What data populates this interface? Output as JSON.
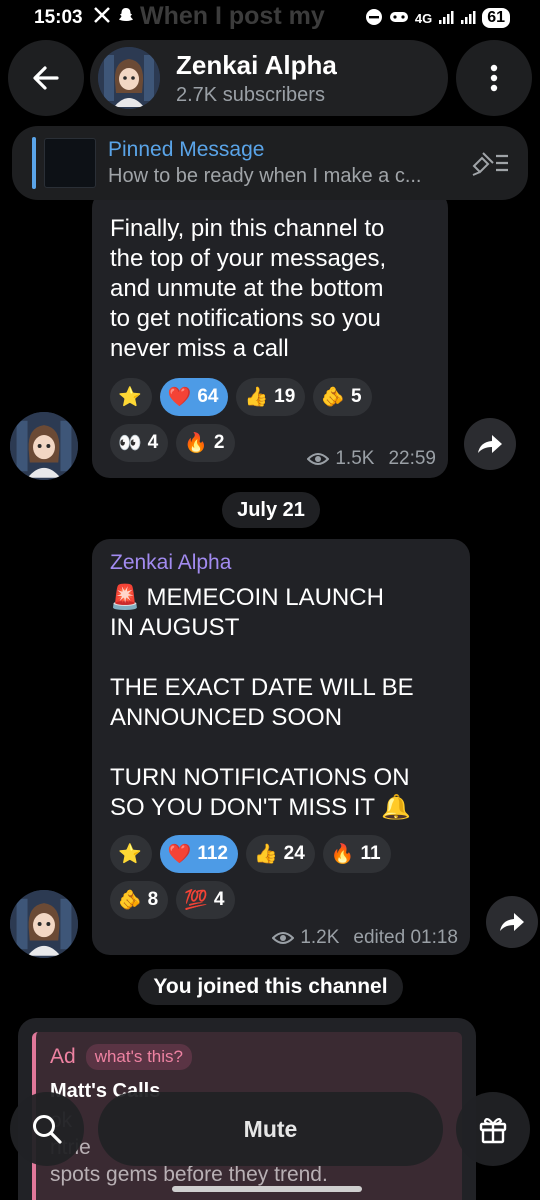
{
  "status_bar": {
    "time": "15:03",
    "left_icons": [
      "x-logo-icon",
      "snapchat-icon"
    ],
    "right_icons": [
      "dnd-icon",
      "game-icon",
      "signal-4g-icon",
      "signal-icon",
      "signal-icon"
    ],
    "network": "4G",
    "battery": "61"
  },
  "background_ghost_text": "When I post my",
  "header": {
    "channel_name": "Zenkai Alpha",
    "subscribers": "2.7K subscribers"
  },
  "pinned": {
    "label": "Pinned Message",
    "preview": "How to be ready when I make a c..."
  },
  "messages": [
    {
      "text": "Finally, pin this channel to\nthe top of your messages,\nand unmute at the bottom\nto get notifications so you\nnever miss a call",
      "reactions": [
        {
          "emoji": "⭐",
          "count": "",
          "active": false
        },
        {
          "emoji": "❤️",
          "count": "64",
          "active": true
        },
        {
          "emoji": "👍",
          "count": "19",
          "active": false
        },
        {
          "emoji": "🫵",
          "count": "5",
          "active": false
        },
        {
          "emoji": "👀",
          "count": "4",
          "active": false
        },
        {
          "emoji": "🔥",
          "count": "2",
          "active": false
        }
      ],
      "views": "1.5K",
      "time": "22:59"
    },
    {
      "sender": "Zenkai Alpha",
      "text": "🚨 MEMECOIN LAUNCH\nIN AUGUST\n\nTHE EXACT DATE WILL BE\nANNOUNCED SOON\n\nTURN NOTIFICATIONS ON\nSO YOU DON'T MISS IT 🔔",
      "reactions": [
        {
          "emoji": "⭐",
          "count": "",
          "active": false
        },
        {
          "emoji": "❤️",
          "count": "112",
          "active": true
        },
        {
          "emoji": "👍",
          "count": "24",
          "active": false
        },
        {
          "emoji": "🔥",
          "count": "11",
          "active": false
        },
        {
          "emoji": "🫵",
          "count": "8",
          "active": false
        },
        {
          "emoji": "💯",
          "count": "4",
          "active": false
        }
      ],
      "views": "1.2K",
      "time": "edited 01:18"
    }
  ],
  "date_divider": "July 21",
  "system_message": "You joined this channel",
  "ad": {
    "label": "Ad",
    "whats_this": "what's this?",
    "title": "Matt's Calls",
    "text": "ok\nntrie\nspots gems before they trend."
  },
  "bottom": {
    "mute_label": "Mute"
  }
}
